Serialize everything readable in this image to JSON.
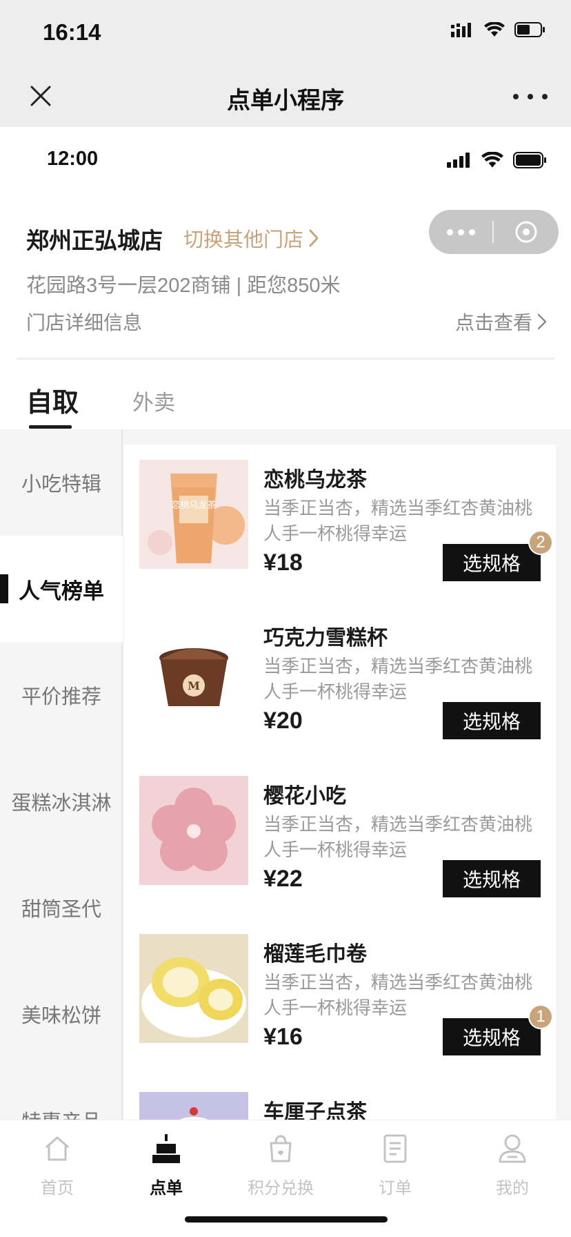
{
  "outer_status": {
    "time": "16:14"
  },
  "miniapp_nav": {
    "title": "点单小程序"
  },
  "inner_status": {
    "time": "12:00"
  },
  "store": {
    "name": "郑州正弘城店",
    "switch_label": "切换其他门店",
    "address": "花园路3号一层202商铺 | 距您850米",
    "detail_label": "门店详细信息",
    "view_label": "点击查看"
  },
  "mode_tabs": [
    {
      "label": "自取",
      "active": true
    },
    {
      "label": "外卖",
      "active": false
    }
  ],
  "categories": [
    {
      "label": "小吃特辑",
      "active": false
    },
    {
      "label": "人气榜单",
      "active": true
    },
    {
      "label": "平价推荐",
      "active": false
    },
    {
      "label": "蛋糕冰淇淋",
      "active": false
    },
    {
      "label": "甜筒圣代",
      "active": false
    },
    {
      "label": "美味松饼",
      "active": false
    },
    {
      "label": "特惠产品",
      "active": false
    }
  ],
  "products": [
    {
      "name": "恋桃乌龙茶",
      "desc": "当季正当杏，精选当季红杏黄油桃人手一杯桃得幸运",
      "price": "¥18",
      "button": "选规格",
      "badge": "2",
      "thumb_text": "恋桃乌龙茶"
    },
    {
      "name": "巧克力雪糕杯",
      "desc": "当季正当杏，精选当季红杏黄油桃人手一杯桃得幸运",
      "price": "¥20",
      "button": "选规格",
      "badge": "",
      "thumb_text": "M"
    },
    {
      "name": "樱花小吃",
      "desc": "当季正当杏，精选当季红杏黄油桃人手一杯桃得幸运",
      "price": "¥22",
      "button": "选规格",
      "badge": "",
      "thumb_text": ""
    },
    {
      "name": "榴莲毛巾卷",
      "desc": "当季正当杏，精选当季红杏黄油桃人手一杯桃得幸运",
      "price": "¥16",
      "button": "选规格",
      "badge": "1",
      "thumb_text": ""
    },
    {
      "name": "车厘子点茶",
      "desc": "",
      "price": "",
      "button": "",
      "badge": "",
      "thumb_text": ""
    }
  ],
  "tabbar": [
    {
      "label": "首页",
      "icon": "home-icon",
      "active": false
    },
    {
      "label": "点单",
      "icon": "cake-icon",
      "active": true
    },
    {
      "label": "积分兑换",
      "icon": "points-bag-icon",
      "active": false
    },
    {
      "label": "订单",
      "icon": "order-list-icon",
      "active": false
    },
    {
      "label": "我的",
      "icon": "user-icon",
      "active": false
    }
  ],
  "colors": {
    "accent": "#c8a47a",
    "dark": "#111111",
    "muted": "#9a9a9a",
    "bg": "#f5f5f5"
  }
}
